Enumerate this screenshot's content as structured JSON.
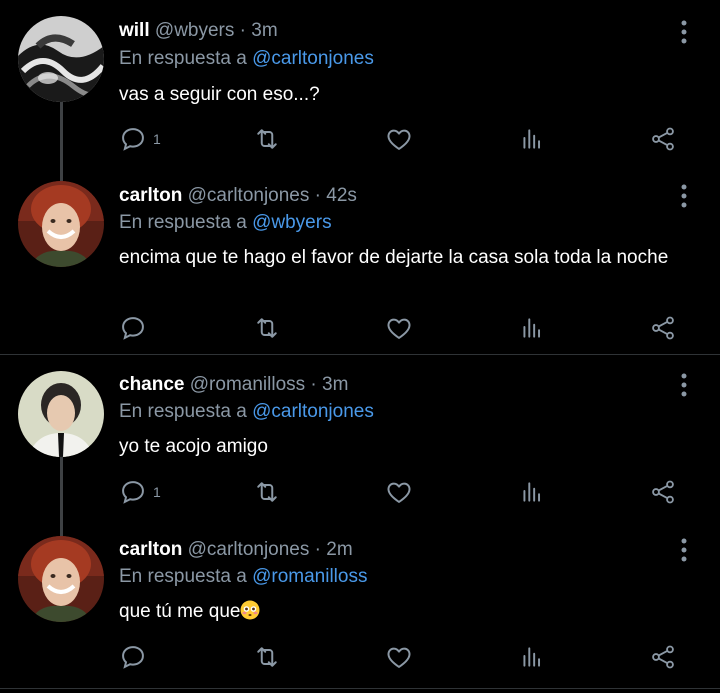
{
  "colors": {
    "background": "#000000",
    "name": "#ffffff",
    "muted": "#8b98a5",
    "mention": "#4a99e9",
    "divider": "#2f3336"
  },
  "tweets": [
    {
      "name": "will",
      "handle": "@wbyers",
      "dot": "·",
      "time": "3m",
      "reply_prefix": "En respuesta a",
      "reply_to": "@carltonjones",
      "text": "vas a seguir con eso...?",
      "reply_count": "1",
      "avatar": "avatar-will"
    },
    {
      "name": "carlton",
      "handle": "@carltonjones",
      "dot": "·",
      "time": "42s",
      "reply_prefix": "En respuesta a",
      "reply_to": "@wbyers",
      "text": "encima que te hago el favor de dejarte la casa sola toda la noche",
      "reply_count": "",
      "avatar": "avatar-carlton"
    },
    {
      "name": "chance",
      "handle": "@romanilloss",
      "dot": "·",
      "time": "3m",
      "reply_prefix": "En respuesta a",
      "reply_to": "@carltonjones",
      "text": "yo te acojo amigo",
      "reply_count": "1",
      "avatar": "avatar-chance"
    },
    {
      "name": "carlton",
      "handle": "@carltonjones",
      "dot": "·",
      "time": "2m",
      "reply_prefix": "En respuesta a",
      "reply_to": "@romanilloss",
      "text": "que tú me que",
      "reply_count": "",
      "avatar": "avatar-carlton",
      "emoji": "flushed-face-emoji"
    }
  ],
  "icons": [
    "reply-icon",
    "retweet-icon",
    "like-icon",
    "views-icon",
    "share-icon",
    "more-icon"
  ]
}
